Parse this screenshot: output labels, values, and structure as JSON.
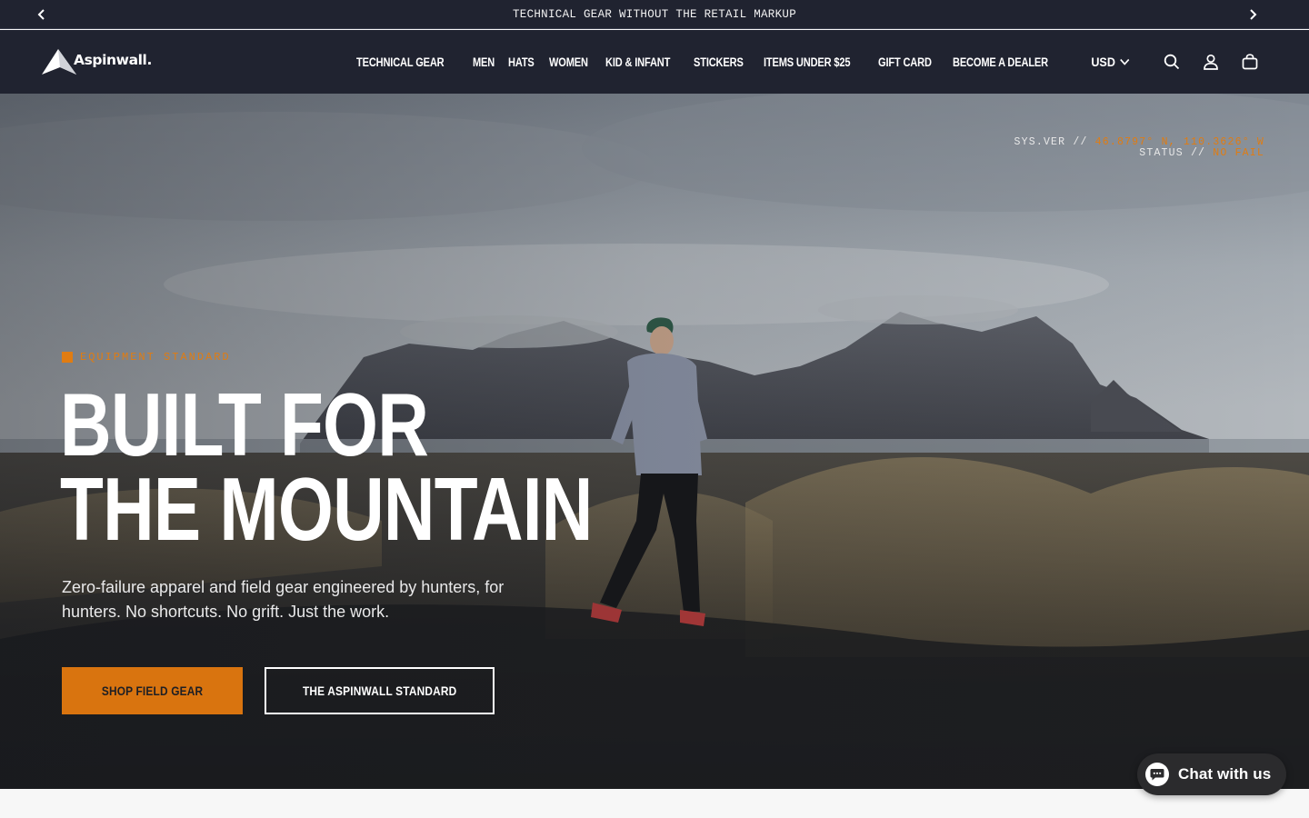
{
  "announcement": {
    "text": "TECHNICAL GEAR WITHOUT THE RETAIL MARKUP"
  },
  "header": {
    "logo_text": "Aspinwall.",
    "nav": [
      "TECHNICAL GEAR",
      "MEN",
      "HATS",
      "WOMEN",
      "KID & INFANT",
      "STICKERS",
      "ITEMS UNDER $25",
      "GIFT CARD",
      "BECOME A DEALER"
    ],
    "currency": "USD"
  },
  "hero": {
    "sys_label": "SYS.VER //",
    "sys_value": "46.8797° N, 110.3626° W",
    "status_label": "STATUS //",
    "status_value": "NO FAIL",
    "eyebrow": "EQUIPMENT STANDARD",
    "title_line1": "BUILT FOR",
    "title_line2": "THE MOUNTAIN",
    "subtitle": "Zero-failure apparel and field gear engineered by hunters, for hunters. No shortcuts. No grift. Just the work.",
    "primary_cta": "SHOP FIELD GEAR",
    "secondary_cta": "THE ASPINWALL STANDARD"
  },
  "chat": {
    "label": "Chat with us"
  },
  "colors": {
    "accent": "#e07c12",
    "header_bg": "#202330",
    "button_orange": "#d9740f"
  },
  "icons": [
    "chevron-left-icon",
    "chevron-right-icon",
    "logo-mountain-icon",
    "chevron-down-icon",
    "search-icon",
    "account-icon",
    "cart-icon",
    "chat-icon"
  ]
}
